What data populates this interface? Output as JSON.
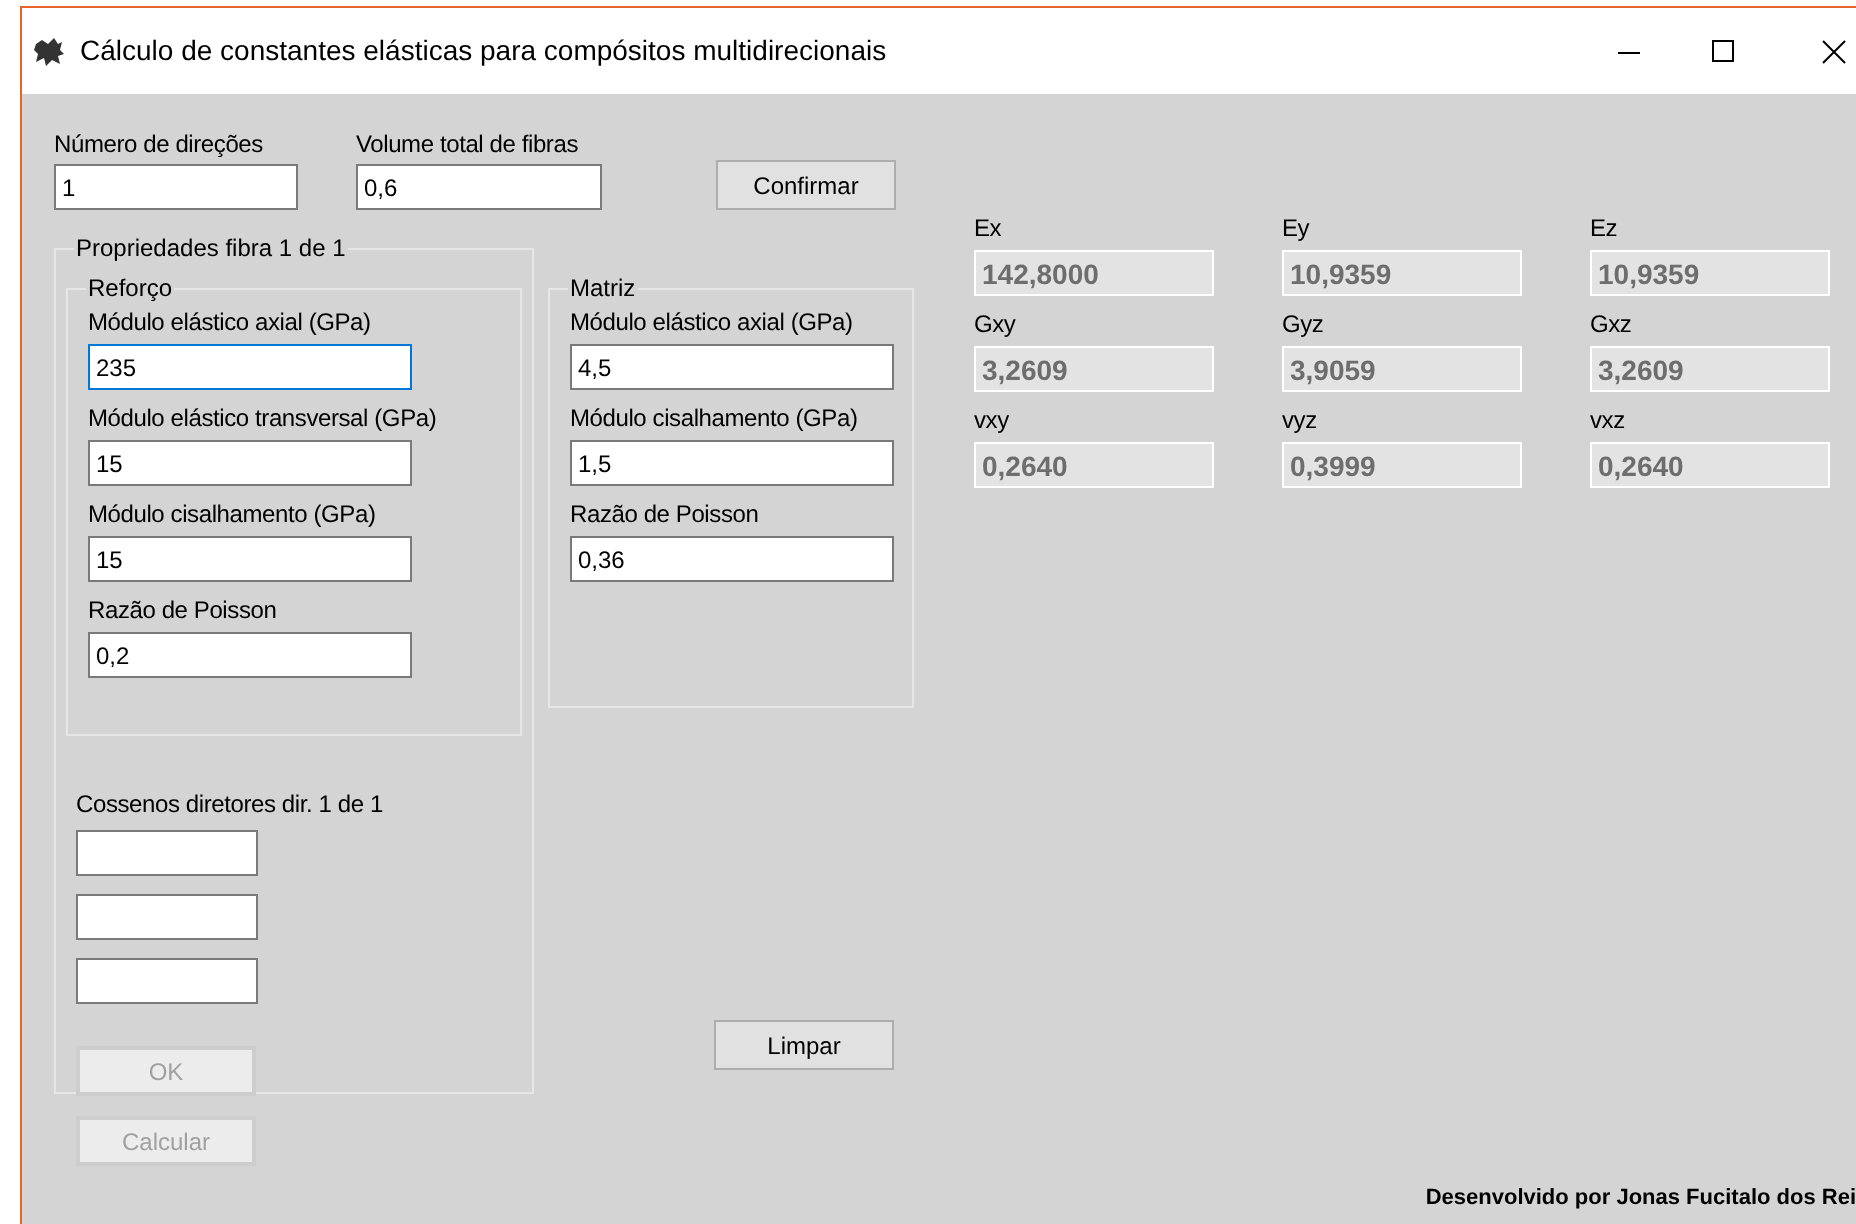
{
  "window": {
    "title": "Cálculo de constantes elásticas para compósitos multidirecionais"
  },
  "top_fields": [
    {
      "label": "Número de direções",
      "value": "1",
      "focused": false
    },
    {
      "label": "Volume total de fibras",
      "value": "0,6",
      "focused": false
    }
  ],
  "confirm_button": {
    "label": "Confirmar",
    "disabled": false
  },
  "fiber_group": {
    "title": "Propriedades fibra 1 de 1",
    "reinforcement": {
      "title": "Reforço",
      "fields": [
        {
          "label": "Módulo elástico axial (GPa)",
          "value": "235",
          "focused": true
        },
        {
          "label": "Módulo elástico transversal (GPa)",
          "value": "15",
          "focused": false
        },
        {
          "label": "Módulo cisalhamento (GPa)",
          "value": "15",
          "focused": false
        },
        {
          "label": "Razão de Poisson",
          "value": "0,2",
          "focused": false
        }
      ]
    },
    "direction_cosines": {
      "label": "Cossenos diretores dir. 1 de 1",
      "fields": [
        {
          "focused": false
        },
        {
          "focused": false
        },
        {
          "focused": false
        }
      ]
    },
    "ok_button": {
      "label": "OK",
      "disabled": true
    }
  },
  "matrix": {
    "title": "Matriz",
    "fields": [
      {
        "label": "Módulo elástico axial (GPa)",
        "value": "4,5",
        "focused": false
      },
      {
        "label": "Módulo cisalhamento (GPa)",
        "value": "1,5",
        "focused": false
      },
      {
        "label": "Razão de Poisson",
        "value": "0,36",
        "focused": false
      }
    ]
  },
  "clear_button": {
    "label": "Limpar",
    "disabled": false
  },
  "calculate_button": {
    "label": "Calcular",
    "disabled": true
  },
  "results": [
    {
      "label": "Ex",
      "value": "142,8000",
      "disabled": true
    },
    {
      "label": "Ey",
      "value": "10,9359",
      "disabled": true
    },
    {
      "label": "Ez",
      "value": "10,9359",
      "disabled": true
    },
    {
      "label": "Gxy",
      "value": "3,2609",
      "disabled": true
    },
    {
      "label": "Gyz",
      "value": "3,9059",
      "disabled": true
    },
    {
      "label": "Gxz",
      "value": "3,2609",
      "disabled": true
    },
    {
      "label": "vxy",
      "value": "0,2640",
      "disabled": true
    },
    {
      "label": "vyz",
      "value": "0,3999",
      "disabled": true
    },
    {
      "label": "vxz",
      "value": "0,2640",
      "disabled": true
    }
  ],
  "footer": "Desenvolvido por Jonas Fucitalo dos Rei"
}
